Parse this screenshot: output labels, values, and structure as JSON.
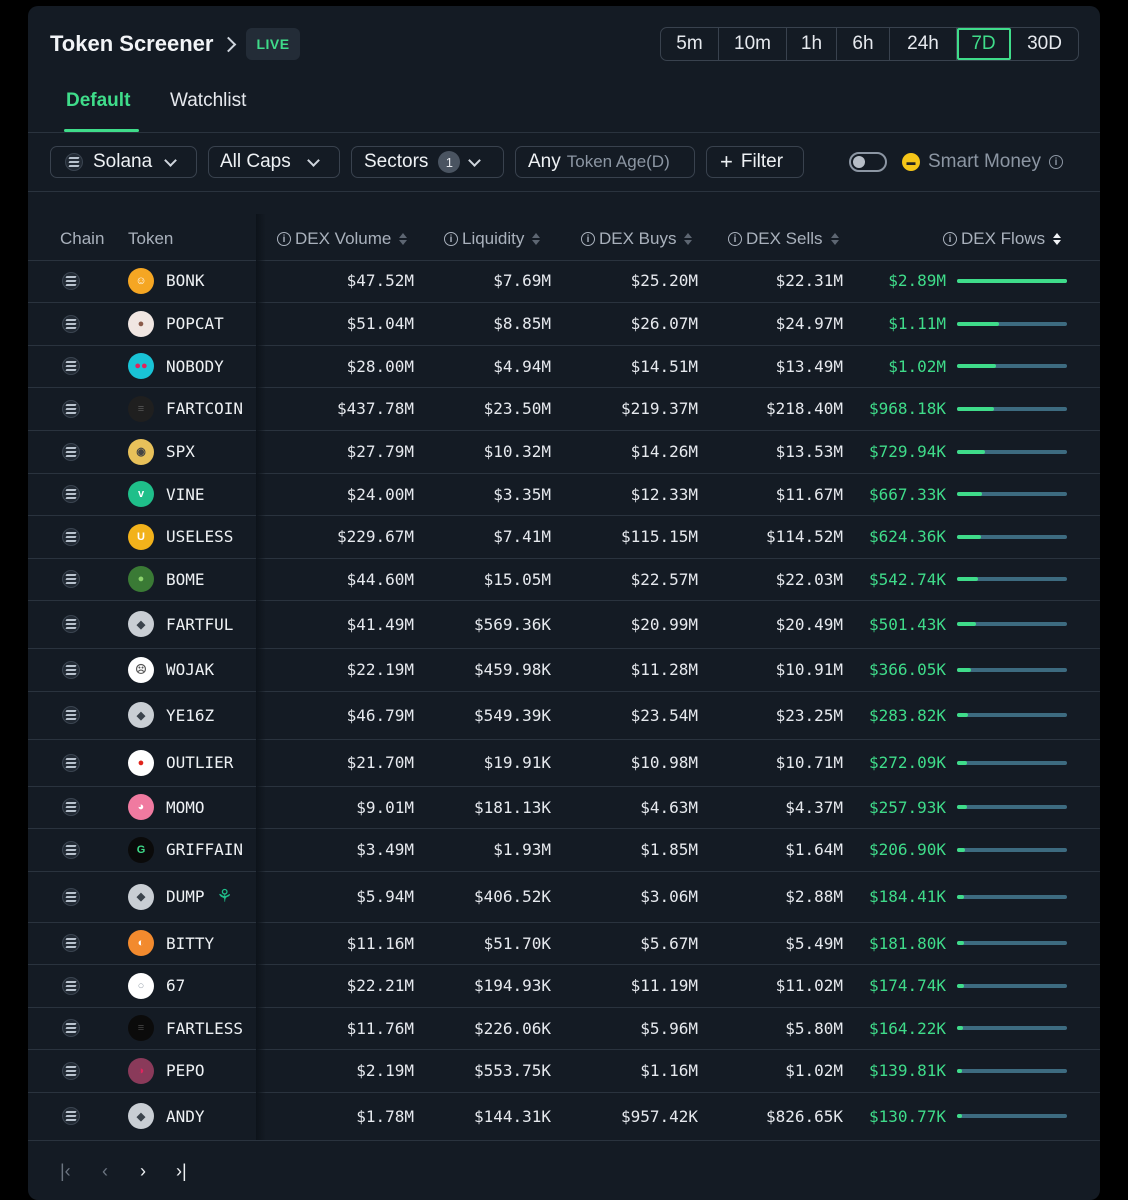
{
  "header": {
    "title": "Token Screener",
    "live_badge": "LIVE"
  },
  "timeframes": [
    {
      "label": "5m",
      "active": false
    },
    {
      "label": "10m",
      "active": false
    },
    {
      "label": "1h",
      "active": false
    },
    {
      "label": "6h",
      "active": false
    },
    {
      "label": "24h",
      "active": false
    },
    {
      "label": "7D",
      "active": true
    },
    {
      "label": "30D",
      "active": false
    }
  ],
  "tabs": [
    {
      "label": "Default",
      "active": true
    },
    {
      "label": "Watchlist",
      "active": false
    }
  ],
  "filters": {
    "chain": "Solana",
    "caps": "All Caps",
    "sectors": "Sectors",
    "sectors_count": "1",
    "age_prefix": "Any",
    "age_label": "Token Age(D)",
    "add_filter": "Filter",
    "smart_money": "Smart Money"
  },
  "columns": {
    "chain": "Chain",
    "token": "Token",
    "dex_volume": "DEX Volume",
    "liquidity": "Liquidity",
    "dex_buys": "DEX Buys",
    "dex_sells": "DEX Sells",
    "dex_flows": "DEX Flows"
  },
  "rows": [
    {
      "token": "BONK",
      "volume": "$47.52M",
      "liquidity": "$7.69M",
      "buys": "$25.20M",
      "sells": "$22.31M",
      "flows": "$2.89M",
      "flow_fraction": 1.0,
      "avatar_color": "#f5a623",
      "avatar_glyph": "☺",
      "avatar_text_color": "#ffffff"
    },
    {
      "token": "POPCAT",
      "volume": "$51.04M",
      "liquidity": "$8.85M",
      "buys": "$26.07M",
      "sells": "$24.97M",
      "flows": "$1.11M",
      "flow_fraction": 0.384,
      "avatar_color": "#f0e6e2",
      "avatar_glyph": "●",
      "avatar_text_color": "#8a5a4a"
    },
    {
      "token": "NOBODY",
      "volume": "$28.00M",
      "liquidity": "$4.94M",
      "buys": "$14.51M",
      "sells": "$13.49M",
      "flows": "$1.02M",
      "flow_fraction": 0.353,
      "avatar_color": "#19c3d6",
      "avatar_glyph": "●●",
      "avatar_text_color": "#e0245e"
    },
    {
      "token": "FARTCOIN",
      "volume": "$437.78M",
      "liquidity": "$23.50M",
      "buys": "$219.37M",
      "sells": "$218.40M",
      "flows": "$968.18K",
      "flow_fraction": 0.335,
      "avatar_color": "#1f1f1f",
      "avatar_glyph": "≡",
      "avatar_text_color": "#555555"
    },
    {
      "token": "SPX",
      "volume": "$27.79M",
      "liquidity": "$10.32M",
      "buys": "$14.26M",
      "sells": "$13.53M",
      "flows": "$729.94K",
      "flow_fraction": 0.253,
      "avatar_color": "#e8c15a",
      "avatar_glyph": "◉",
      "avatar_text_color": "#444444"
    },
    {
      "token": "VINE",
      "volume": "$24.00M",
      "liquidity": "$3.35M",
      "buys": "$12.33M",
      "sells": "$11.67M",
      "flows": "$667.33K",
      "flow_fraction": 0.231,
      "avatar_color": "#1fbf8a",
      "avatar_glyph": "v",
      "avatar_text_color": "#ffffff"
    },
    {
      "token": "USELESS",
      "volume": "$229.67M",
      "liquidity": "$7.41M",
      "buys": "$115.15M",
      "sells": "$114.52M",
      "flows": "$624.36K",
      "flow_fraction": 0.216,
      "avatar_color": "#f2b21b",
      "avatar_glyph": "U",
      "avatar_text_color": "#ffffff"
    },
    {
      "token": "BOME",
      "volume": "$44.60M",
      "liquidity": "$15.05M",
      "buys": "$22.57M",
      "sells": "$22.03M",
      "flows": "$542.74K",
      "flow_fraction": 0.188,
      "avatar_color": "#3a7a35",
      "avatar_glyph": "●",
      "avatar_text_color": "#8bd36c"
    },
    {
      "token": "FARTFUL",
      "volume": "$41.49M",
      "liquidity": "$569.36K",
      "buys": "$20.99M",
      "sells": "$20.49M",
      "flows": "$501.43K",
      "flow_fraction": 0.174,
      "avatar_color": "#c9ced4",
      "avatar_glyph": "◆",
      "avatar_text_color": "#3b434c"
    },
    {
      "token": "WOJAK",
      "volume": "$22.19M",
      "liquidity": "$459.98K",
      "buys": "$11.28M",
      "sells": "$10.91M",
      "flows": "$366.05K",
      "flow_fraction": 0.127,
      "avatar_color": "#ffffff",
      "avatar_glyph": "☹",
      "avatar_text_color": "#555555"
    },
    {
      "token": "YE16Z",
      "volume": "$46.79M",
      "liquidity": "$549.39K",
      "buys": "$23.54M",
      "sells": "$23.25M",
      "flows": "$283.82K",
      "flow_fraction": 0.098,
      "avatar_color": "#c9ced4",
      "avatar_glyph": "◆",
      "avatar_text_color": "#3b434c"
    },
    {
      "token": "OUTLIER",
      "volume": "$21.70M",
      "liquidity": "$19.91K",
      "buys": "$10.98M",
      "sells": "$10.71M",
      "flows": "$272.09K",
      "flow_fraction": 0.094,
      "avatar_color": "#ffffff",
      "avatar_glyph": "●",
      "avatar_text_color": "#e0241b"
    },
    {
      "token": "MOMO",
      "volume": "$9.01M",
      "liquidity": "$181.13K",
      "buys": "$4.63M",
      "sells": "$4.37M",
      "flows": "$257.93K",
      "flow_fraction": 0.089,
      "avatar_color": "#f07aa0",
      "avatar_glyph": "◕",
      "avatar_text_color": "#ffffff"
    },
    {
      "token": "GRIFFAIN",
      "volume": "$3.49M",
      "liquidity": "$1.93M",
      "buys": "$1.85M",
      "sells": "$1.64M",
      "flows": "$206.90K",
      "flow_fraction": 0.072,
      "avatar_color": "#0a0a0a",
      "avatar_glyph": "G",
      "avatar_text_color": "#3fdc8a"
    },
    {
      "token": "DUMP",
      "volume": "$5.94M",
      "liquidity": "$406.52K",
      "buys": "$3.06M",
      "sells": "$2.88M",
      "flows": "$184.41K",
      "flow_fraction": 0.064,
      "avatar_color": "#c9ced4",
      "avatar_glyph": "◆",
      "avatar_text_color": "#3b434c",
      "new_listing": true
    },
    {
      "token": "BITTY",
      "volume": "$11.16M",
      "liquidity": "$51.70K",
      "buys": "$5.67M",
      "sells": "$5.49M",
      "flows": "$181.80K",
      "flow_fraction": 0.063,
      "avatar_color": "#f28a2e",
      "avatar_glyph": "◐",
      "avatar_text_color": "#ffffff"
    },
    {
      "token": "67",
      "volume": "$22.21M",
      "liquidity": "$194.93K",
      "buys": "$11.19M",
      "sells": "$11.02M",
      "flows": "$174.74K",
      "flow_fraction": 0.06,
      "avatar_color": "#ffffff",
      "avatar_glyph": "○",
      "avatar_text_color": "#9aa3ad"
    },
    {
      "token": "FARTLESS",
      "volume": "$11.76M",
      "liquidity": "$226.06K",
      "buys": "$5.96M",
      "sells": "$5.80M",
      "flows": "$164.22K",
      "flow_fraction": 0.057,
      "avatar_color": "#0b0b0b",
      "avatar_glyph": "≡",
      "avatar_text_color": "#444444"
    },
    {
      "token": "PEPO",
      "volume": "$2.19M",
      "liquidity": "$553.75K",
      "buys": "$1.16M",
      "sells": "$1.02M",
      "flows": "$139.81K",
      "flow_fraction": 0.048,
      "avatar_color": "#8a3a5a",
      "avatar_glyph": "◑",
      "avatar_text_color": "#e0245e"
    },
    {
      "token": "ANDY",
      "volume": "$1.78M",
      "liquidity": "$144.31K",
      "buys": "$957.42K",
      "sells": "$826.65K",
      "flows": "$130.77K",
      "flow_fraction": 0.045,
      "avatar_color": "#c9ced4",
      "avatar_glyph": "◆",
      "avatar_text_color": "#3b434c"
    }
  ],
  "colors": {
    "accent": "#3fdc8a",
    "bar_track": "#3d6b80",
    "panel": "#141b24"
  },
  "pagination": {
    "first": "first-page",
    "prev": "prev-page",
    "next": "next-page",
    "last": "last-page"
  }
}
